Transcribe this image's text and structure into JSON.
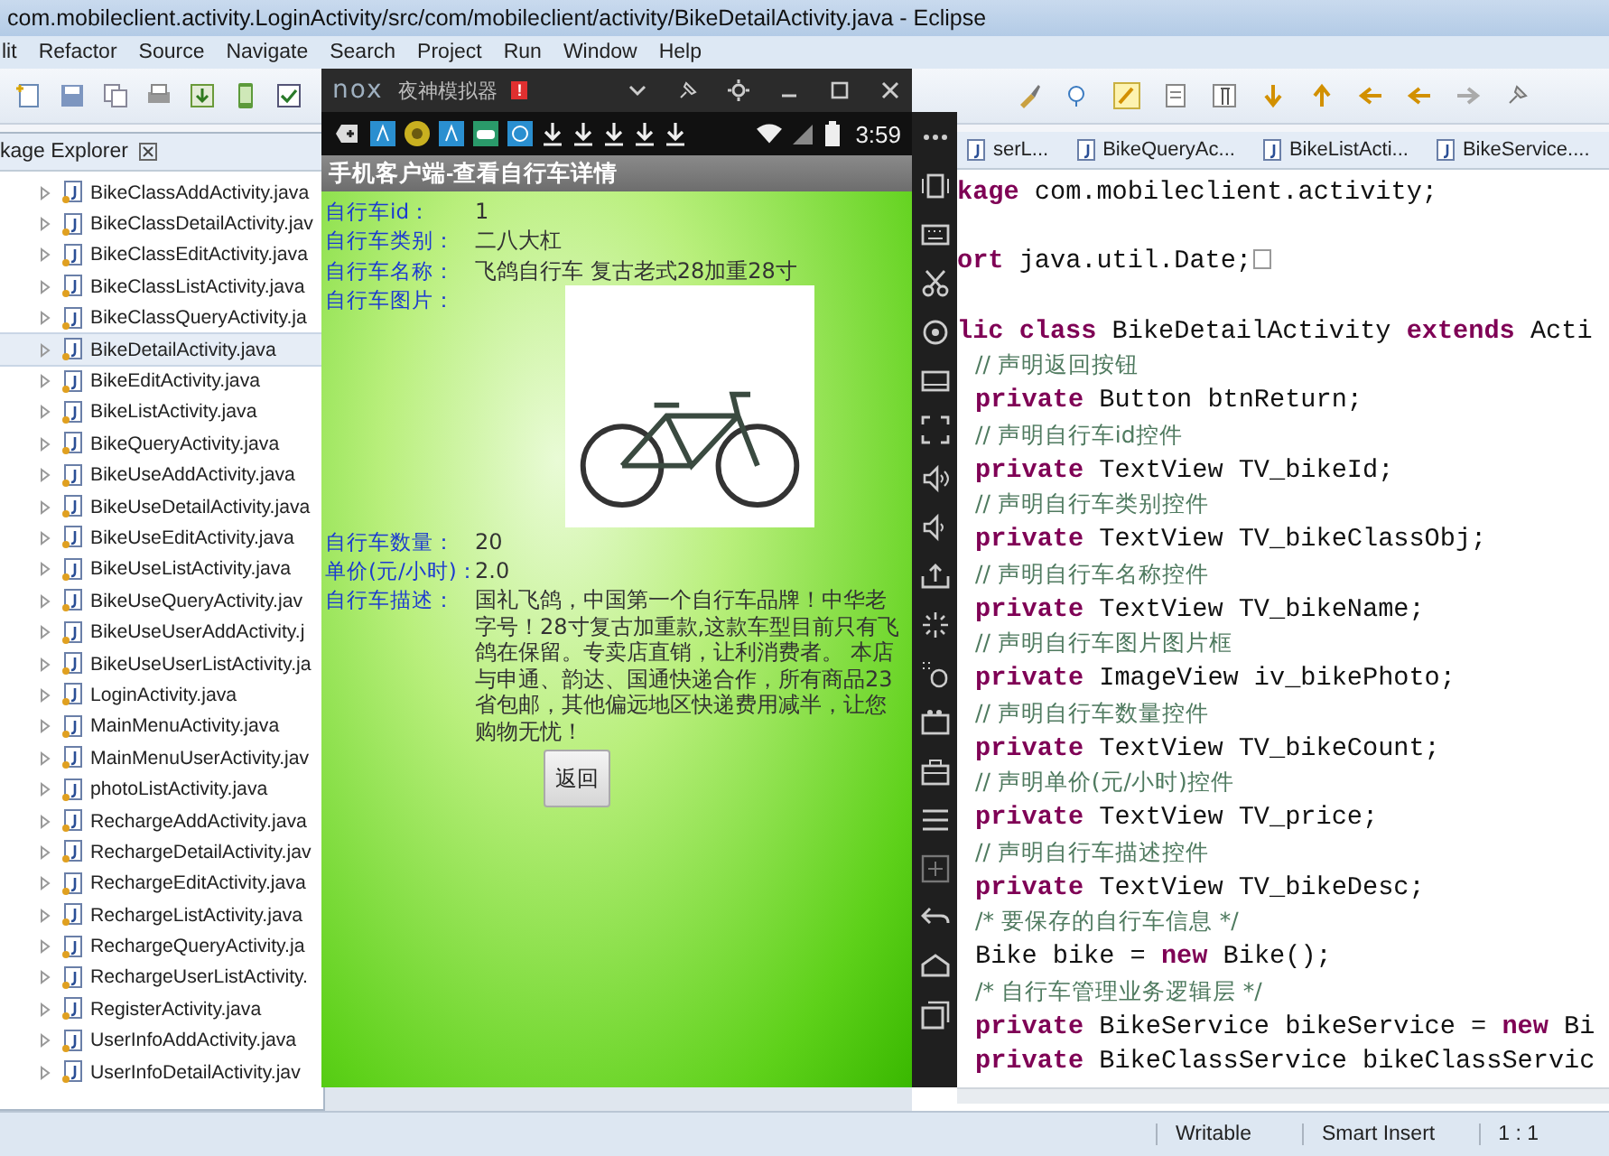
{
  "window": {
    "title": "com.mobileclient.activity.LoginActivity/src/com/mobileclient/activity/BikeDetailActivity.java - Eclipse"
  },
  "menu": [
    "lit",
    "Refactor",
    "Source",
    "Navigate",
    "Search",
    "Project",
    "Run",
    "Window",
    "Help"
  ],
  "package_explorer": {
    "tab": "kage Explorer",
    "items": [
      {
        "label": "BikeClassAddActivity.java",
        "selected": false
      },
      {
        "label": "BikeClassDetailActivity.jav",
        "selected": false
      },
      {
        "label": "BikeClassEditActivity.java",
        "selected": false
      },
      {
        "label": "BikeClassListActivity.java",
        "selected": false
      },
      {
        "label": "BikeClassQueryActivity.ja",
        "selected": false
      },
      {
        "label": "BikeDetailActivity.java",
        "selected": true
      },
      {
        "label": "BikeEditActivity.java",
        "selected": false
      },
      {
        "label": "BikeListActivity.java",
        "selected": false
      },
      {
        "label": "BikeQueryActivity.java",
        "selected": false
      },
      {
        "label": "BikeUseAddActivity.java",
        "selected": false
      },
      {
        "label": "BikeUseDetailActivity.java",
        "selected": false
      },
      {
        "label": "BikeUseEditActivity.java",
        "selected": false
      },
      {
        "label": "BikeUseListActivity.java",
        "selected": false
      },
      {
        "label": "BikeUseQueryActivity.jav",
        "selected": false
      },
      {
        "label": "BikeUseUserAddActivity.j",
        "selected": false
      },
      {
        "label": "BikeUseUserListActivity.ja",
        "selected": false
      },
      {
        "label": "LoginActivity.java",
        "selected": false
      },
      {
        "label": "MainMenuActivity.java",
        "selected": false
      },
      {
        "label": "MainMenuUserActivity.jav",
        "selected": false
      },
      {
        "label": "photoListActivity.java",
        "selected": false
      },
      {
        "label": "RechargeAddActivity.java",
        "selected": false
      },
      {
        "label": "RechargeDetailActivity.jav",
        "selected": false
      },
      {
        "label": "RechargeEditActivity.java",
        "selected": false
      },
      {
        "label": "RechargeListActivity.java",
        "selected": false
      },
      {
        "label": "RechargeQueryActivity.ja",
        "selected": false
      },
      {
        "label": "RechargeUserListActivity.",
        "selected": false
      },
      {
        "label": "RegisterActivity.java",
        "selected": false
      },
      {
        "label": "UserInfoAddActivity.java",
        "selected": false
      },
      {
        "label": "UserInfoDetailActivity.jav",
        "selected": false
      }
    ]
  },
  "emulator": {
    "logo": "nox",
    "title": "夜神模拟器",
    "badge": "!",
    "time": "3:59",
    "app_title": "手机客户端-查看自行车详情",
    "fields": [
      {
        "kind": "text",
        "label": "自行车id：",
        "value": "1"
      },
      {
        "kind": "text",
        "label": "自行车类别：",
        "value": "二八大杠"
      },
      {
        "kind": "text",
        "label": "自行车名称：",
        "value": "飞鸽自行车 复古老式28加重28寸"
      },
      {
        "kind": "photo",
        "label": "自行车图片："
      },
      {
        "kind": "text",
        "label": "自行车数量：",
        "value": "20"
      },
      {
        "kind": "text",
        "label": "单价(元/小时)：",
        "value": "2.0"
      },
      {
        "kind": "text",
        "label": "自行车描述：",
        "value": "国礼飞鸽，中国第一个自行车品牌！中华老字号！28寸复古加重款,这款车型目前只有飞鸽在保留。专卖店直销，让利消费者。 本店与申通、韵达、国通快递合作，所有商品23省包邮，其他偏远地区快递费用减半，让您购物无忧！"
      }
    ],
    "button": "返回"
  },
  "editor": {
    "tabs": [
      {
        "label": "serL...",
        "selected": false
      },
      {
        "label": "BikeQueryAc...",
        "selected": false
      },
      {
        "label": "BikeListActi...",
        "selected": false
      },
      {
        "label": "BikeService....",
        "selected": false
      }
    ],
    "lines": [
      {
        "kind": "code",
        "indented": false,
        "text": "**kage** com.mobileclient.activity;"
      },
      {
        "kind": "blank"
      },
      {
        "kind": "code",
        "indented": false,
        "folded": true,
        "text": "**ort** java.util.Date;"
      },
      {
        "kind": "blank"
      },
      {
        "kind": "code",
        "indented": false,
        "text": "**lic class** BikeDetailActivity **extends** Acti"
      },
      {
        "kind": "comment",
        "indented": true,
        "text": "// 声明返回按钮"
      },
      {
        "kind": "code",
        "indented": true,
        "text": "**private** Button btnReturn;"
      },
      {
        "kind": "comment",
        "indented": true,
        "text": "// 声明自行车id控件"
      },
      {
        "kind": "code",
        "indented": true,
        "text": "**private** TextView TV_bikeId;"
      },
      {
        "kind": "comment",
        "indented": true,
        "text": "// 声明自行车类别控件"
      },
      {
        "kind": "code",
        "indented": true,
        "text": "**private** TextView TV_bikeClassObj;"
      },
      {
        "kind": "comment",
        "indented": true,
        "text": "// 声明自行车名称控件"
      },
      {
        "kind": "code",
        "indented": true,
        "text": "**private** TextView TV_bikeName;"
      },
      {
        "kind": "comment",
        "indented": true,
        "text": "// 声明自行车图片图片框"
      },
      {
        "kind": "code",
        "indented": true,
        "text": "**private** ImageView iv_bikePhoto;"
      },
      {
        "kind": "comment",
        "indented": true,
        "text": "// 声明自行车数量控件"
      },
      {
        "kind": "code",
        "indented": true,
        "text": "**private** TextView TV_bikeCount;"
      },
      {
        "kind": "comment",
        "indented": true,
        "text": "// 声明单价(元/小时)控件"
      },
      {
        "kind": "code",
        "indented": true,
        "text": "**private** TextView TV_price;"
      },
      {
        "kind": "comment",
        "indented": true,
        "text": "// 声明自行车描述控件"
      },
      {
        "kind": "code",
        "indented": true,
        "text": "**private** TextView TV_bikeDesc;"
      },
      {
        "kind": "comment",
        "indented": true,
        "text": "/* 要保存的自行车信息 */"
      },
      {
        "kind": "code",
        "indented": true,
        "text": "Bike bike = **new** Bike();"
      },
      {
        "kind": "comment",
        "indented": true,
        "text": "/* 自行车管理业务逻辑层 */"
      },
      {
        "kind": "code",
        "indented": true,
        "text": "**private** BikeService bikeService = **new** Bi"
      },
      {
        "kind": "code",
        "indented": true,
        "text": "**private** BikeClassService bikeClassServic"
      }
    ]
  },
  "status_bar": [
    "Writable",
    "Smart Insert",
    "1 : 1"
  ]
}
